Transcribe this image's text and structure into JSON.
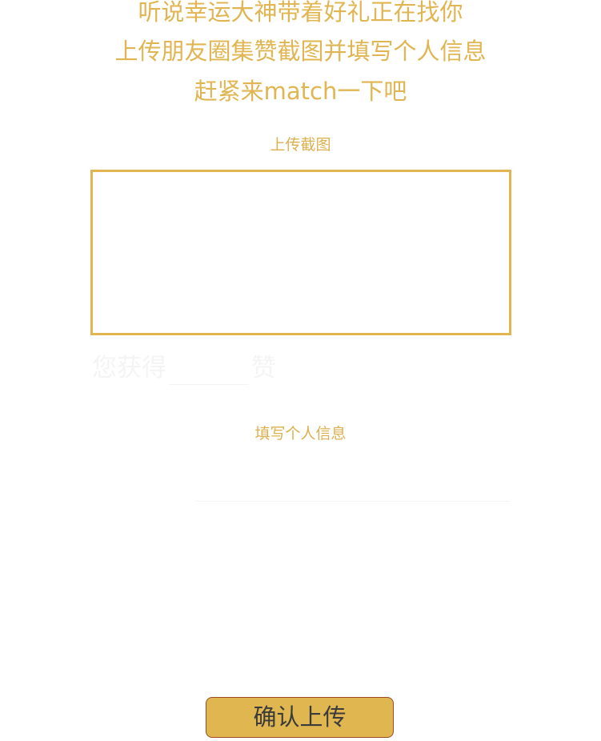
{
  "intro": {
    "line1": "听说幸运大神带着好礼正在找你",
    "line2": "上传朋友圈集赞截图并填写个人信息",
    "line3": "赶紧来match一下吧"
  },
  "upload": {
    "label": "上传截图"
  },
  "likes": {
    "prefix": "您获得",
    "suffix": "赞",
    "value": ""
  },
  "info": {
    "label": "填写个人信息",
    "value": ""
  },
  "confirm": {
    "label": "确认上传"
  },
  "colors": {
    "accent": "#e0b552",
    "button_bg": "#dfb650",
    "button_border": "#9c4a1e",
    "button_text": "#3b3b3b",
    "faint_text": "#f4f4f4"
  }
}
